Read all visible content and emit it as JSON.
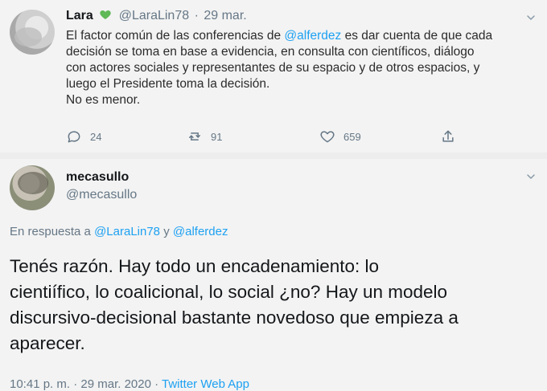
{
  "tweet1": {
    "name": "Lara",
    "handle": "@LaraLin78",
    "separator": "·",
    "date": "29 mar.",
    "body_lines": [
      {
        "pre": "El factor común de las conferencias de ",
        "mention": "@alferdez",
        "post": " es dar cuenta de que cada"
      },
      {
        "text": "decisión se toma en base a evidencia, en consulta con científicos, diálogo"
      },
      {
        "text": "con actores sociales y representantes de su espacio y de otros espacios, y"
      },
      {
        "text": "luego el Presidente toma la decisión."
      },
      {
        "text": "No es menor."
      }
    ],
    "actions": {
      "reply_count": "24",
      "retweet_count": "91",
      "like_count": "659"
    }
  },
  "tweet2": {
    "name": "mecasullo",
    "handle": "@mecasullo",
    "reply": {
      "prefix": "En respuesta a ",
      "mention1": "@LaraLin78",
      "middle": " y ",
      "mention2": "@alferdez"
    },
    "body_lines": [
      "Tenés razón. Hay todo un encadenamiento: lo",
      "cientiífico, lo coalicional, lo social ¿no? Hay un modelo",
      "discursivo-decisional bastante novedoso que empieza a",
      "aparecer."
    ],
    "meta": {
      "time_date": "10:41 p. m. · 29 mar. 2020 · ",
      "source": "Twitter Web App"
    }
  }
}
